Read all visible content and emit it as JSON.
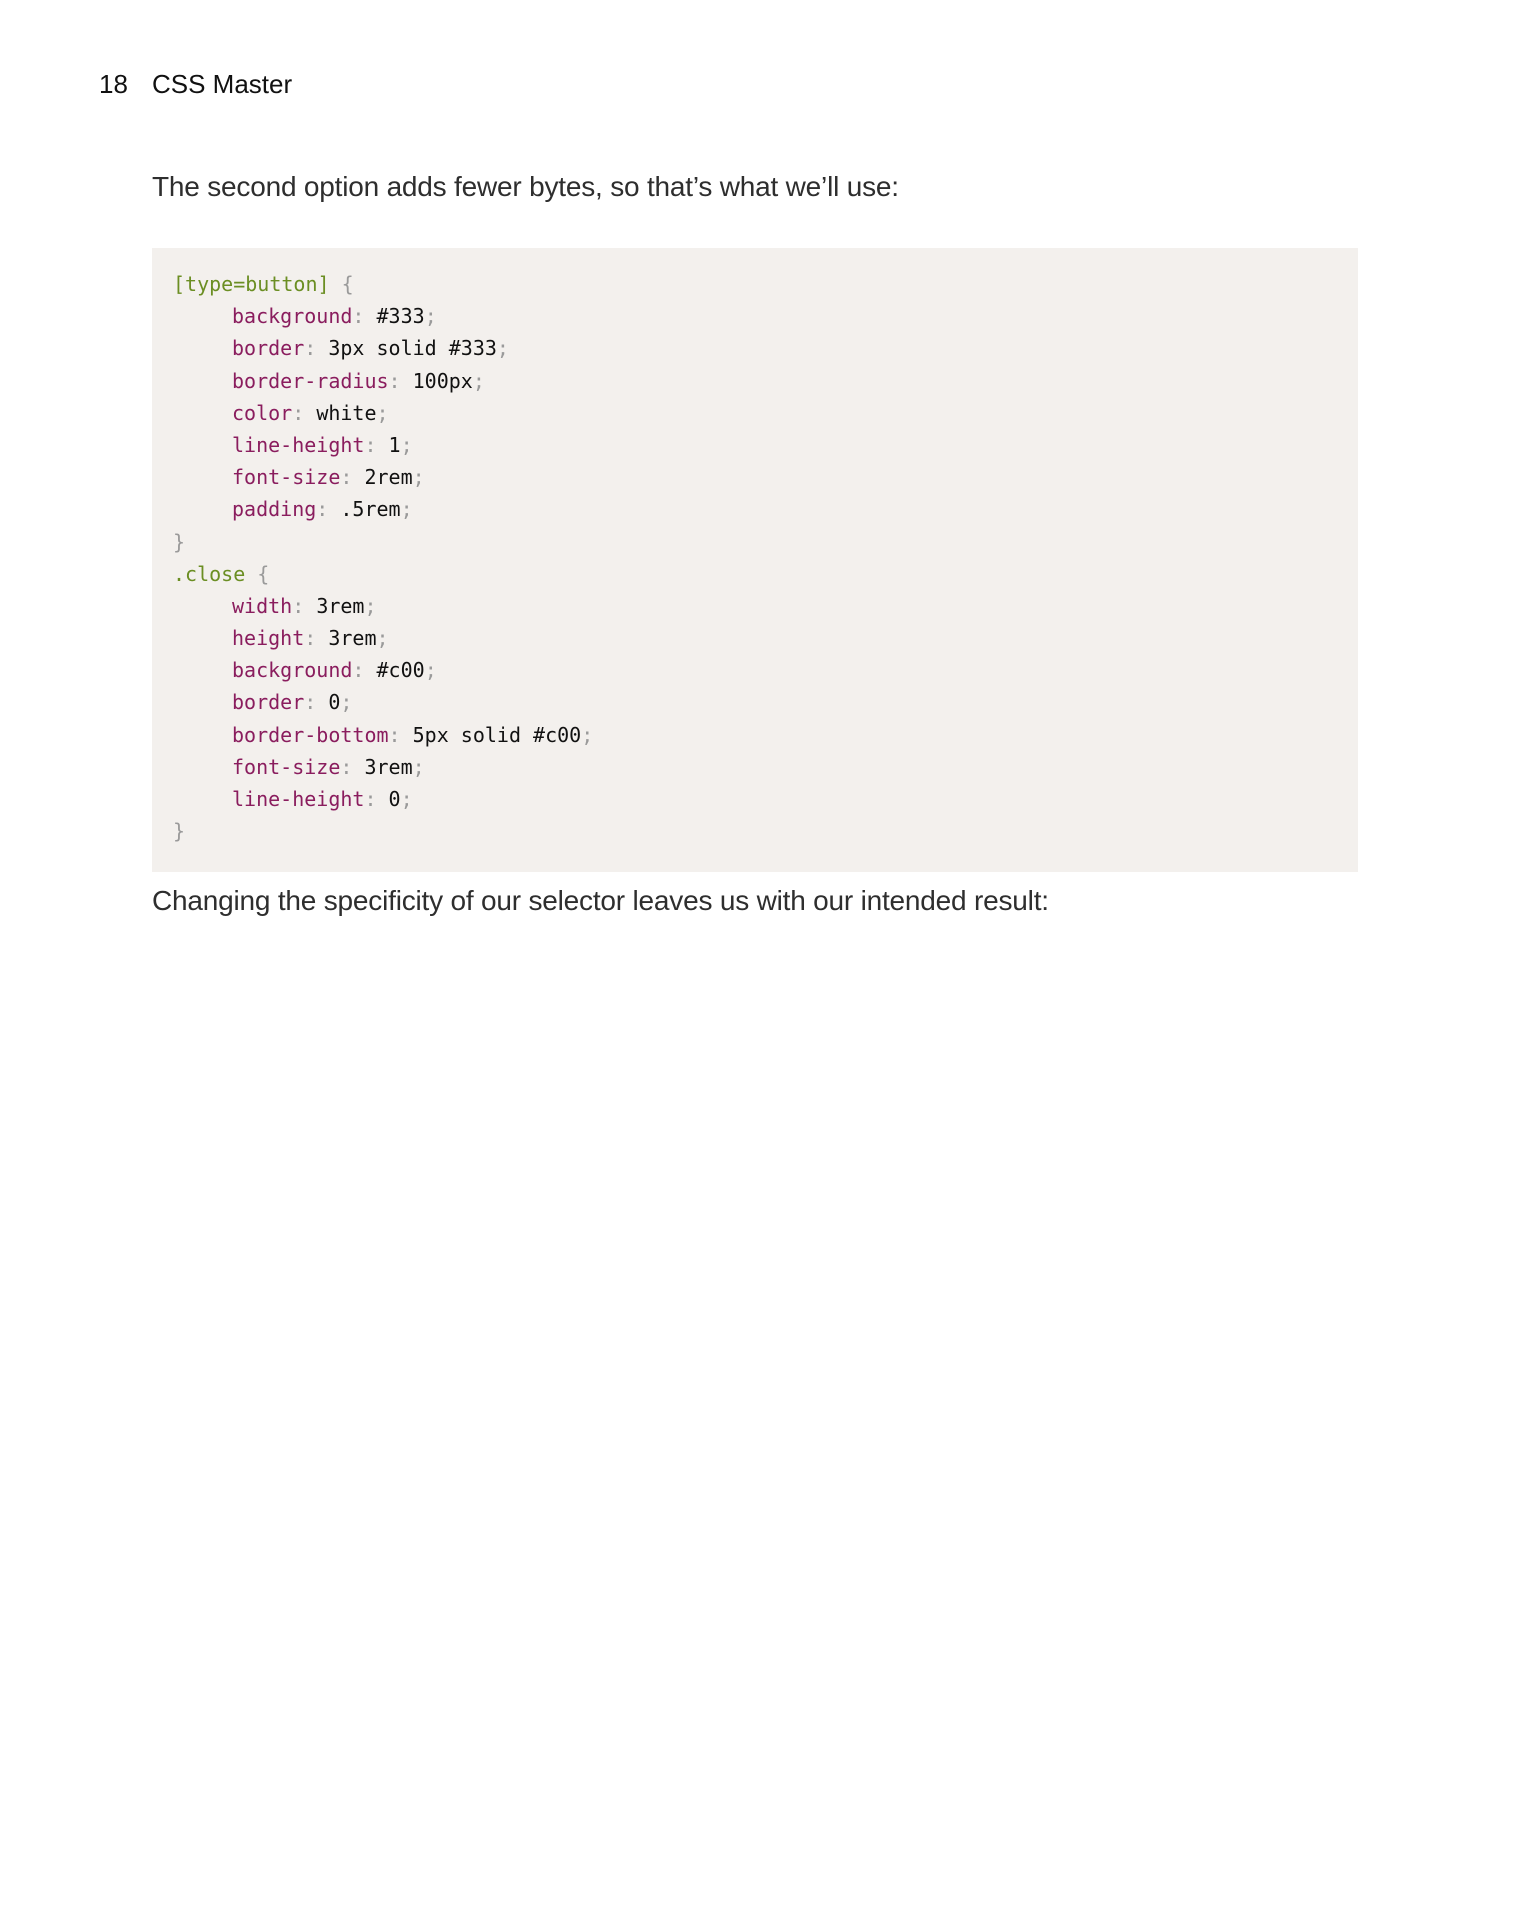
{
  "header": {
    "page_number": "18",
    "book_title": "CSS Master"
  },
  "body": {
    "intro_paragraph": "The second option adds fewer bytes, so that’s what we’ll use:",
    "result_paragraph": "Changing the specificity of our selector leaves us with our intended result:"
  },
  "code": {
    "language": "css",
    "colors": {
      "background": "#f3f0ed",
      "selector": "#6b8e23",
      "property": "#8a1d5e",
      "value": "#111111",
      "punctuation": "#9a9a9a"
    },
    "rules": [
      {
        "selector": "[type=button]",
        "declarations": [
          {
            "property": "background",
            "value": "#333"
          },
          {
            "property": "border",
            "value": "3px solid #333"
          },
          {
            "property": "border-radius",
            "value": "100px"
          },
          {
            "property": "color",
            "value": "white"
          },
          {
            "property": "line-height",
            "value": "1"
          },
          {
            "property": "font-size",
            "value": "2rem"
          },
          {
            "property": "padding",
            "value": ".5rem"
          }
        ]
      },
      {
        "selector": ".close",
        "declarations": [
          {
            "property": "width",
            "value": "3rem"
          },
          {
            "property": "height",
            "value": "3rem"
          },
          {
            "property": "background",
            "value": "#c00"
          },
          {
            "property": "border",
            "value": "0"
          },
          {
            "property": "border-bottom",
            "value": "5px solid #c00"
          },
          {
            "property": "font-size",
            "value": "3rem"
          },
          {
            "property": "line-height",
            "value": "0"
          }
        ]
      }
    ]
  }
}
